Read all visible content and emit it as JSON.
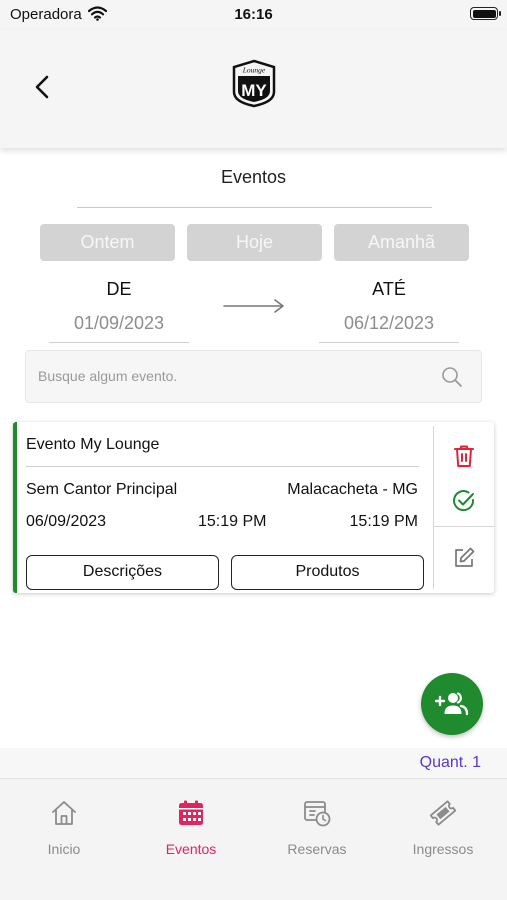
{
  "status_bar": {
    "carrier": "Operadora",
    "time": "16:16"
  },
  "header": {
    "logo_top_text": "Lounge",
    "logo_text": "MY"
  },
  "page": {
    "title": "Eventos"
  },
  "quick_filters": [
    "Ontem",
    "Hoje",
    "Amanhã"
  ],
  "date_range": {
    "from_label": "DE",
    "from_value": "01/09/2023",
    "to_label": "ATÉ",
    "to_value": "06/12/2023"
  },
  "search": {
    "placeholder": "Busque algum evento."
  },
  "event": {
    "name": "Evento My Lounge",
    "singer": "Sem Cantor Principal",
    "city": "Malacacheta - MG",
    "date": "06/09/2023",
    "time_start": "15:19 PM",
    "time_end": "15:19 PM",
    "descriptions_label": "Descrições",
    "products_label": "Produtos",
    "status_color": "#1f8a2e"
  },
  "quantity": {
    "label": "Quant. 1"
  },
  "tabs": [
    {
      "label": "Inicio",
      "icon": "home-icon",
      "active": false
    },
    {
      "label": "Eventos",
      "icon": "calendar-icon",
      "active": true
    },
    {
      "label": "Reservas",
      "icon": "reservation-clock-icon",
      "active": false
    },
    {
      "label": "Ingressos",
      "icon": "ticket-icon",
      "active": false
    }
  ],
  "colors": {
    "accent": "#e0245e",
    "success": "#1f8a2e",
    "danger": "#e0243a",
    "quantity": "#5a37c9"
  }
}
